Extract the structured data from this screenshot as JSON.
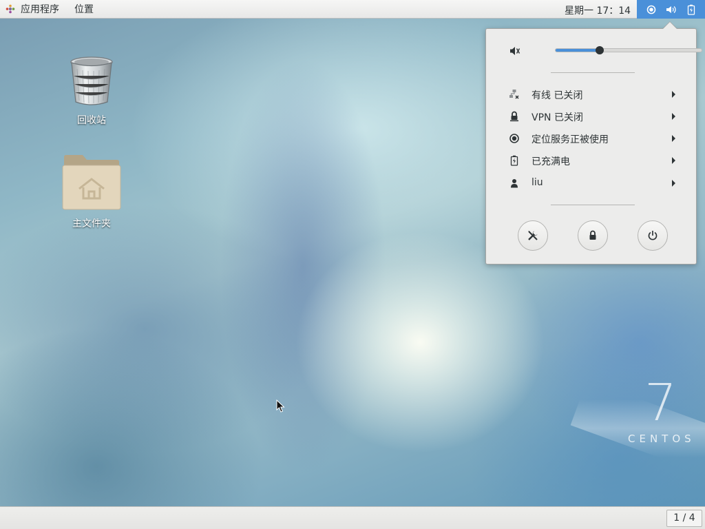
{
  "topbar": {
    "apps_menu_label": "应用程序",
    "places_label": "位置",
    "clock": "星期一 17：14",
    "status_icons": [
      "location-icon",
      "volume-icon",
      "battery-icon"
    ],
    "accent_color": "#4a90d9"
  },
  "desktop": {
    "icons": [
      {
        "label": "回收站",
        "icon": "trash-icon"
      },
      {
        "label": "主文件夹",
        "icon": "home-folder-icon"
      }
    ],
    "watermark": {
      "number": "7",
      "word": "CENTOS"
    }
  },
  "system_menu": {
    "volume": {
      "icon": "speaker-icon",
      "level_fraction": 0.3
    },
    "items": [
      {
        "icon": "wired-network-icon",
        "label": "有线 已关闭"
      },
      {
        "icon": "vpn-lock-icon",
        "label": "VPN 已关闭"
      },
      {
        "icon": "location-icon",
        "label": "定位服务正被使用"
      },
      {
        "icon": "battery-full-icon",
        "label": "已充满电"
      },
      {
        "icon": "user-icon",
        "label": "liu"
      }
    ],
    "action_buttons": [
      "settings-icon",
      "lock-icon",
      "power-icon"
    ]
  },
  "bottombar": {
    "workspace_indicator": "1 / 4"
  }
}
